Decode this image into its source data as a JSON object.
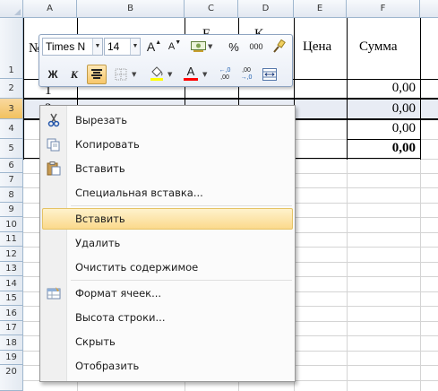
{
  "columns": [
    "A",
    "B",
    "C",
    "D",
    "E",
    "F"
  ],
  "rows": [
    "1",
    "2",
    "3",
    "4",
    "5",
    "6",
    "7",
    "8",
    "9",
    "10",
    "11",
    "12",
    "13",
    "14",
    "15",
    "16",
    "17",
    "18",
    "19",
    "20"
  ],
  "cells": {
    "a1": "№",
    "c1": "Е",
    "d1": "К",
    "e1": "Цена",
    "f1": "Сумма",
    "a2": "1",
    "a3": "2",
    "f2": "0,00",
    "f3": "0,00",
    "f4": "0,00",
    "f5": "0,00"
  },
  "mini_toolbar": {
    "font_name": "Times N",
    "font_size": "14",
    "grow_font": "A",
    "shrink_font": "A",
    "percent": "%",
    "thousands": "000",
    "bold": "Ж",
    "italic": "К",
    "font_color_letter": "A",
    "inc_decimal_top": "←,0",
    "inc_decimal_bottom": ",00",
    "dec_decimal_top": ",00",
    "dec_decimal_bottom": "→,0",
    "fill_color": "#ffff00",
    "font_color": "#ff0000"
  },
  "context_menu": {
    "items": [
      {
        "label": "Вырезать",
        "icon": "scissors-icon"
      },
      {
        "label": "Копировать",
        "icon": "copy-icon"
      },
      {
        "label": "Вставить",
        "icon": "paste-icon"
      },
      {
        "label": "Специальная вставка..."
      },
      {
        "label": "Вставить",
        "highlighted": true
      },
      {
        "label": "Удалить"
      },
      {
        "label": "Очистить содержимое"
      },
      {
        "label": "Формат ячеек...",
        "icon": "format-cells-icon"
      },
      {
        "label": "Высота строки..."
      },
      {
        "label": "Скрыть"
      },
      {
        "label": "Отобразить"
      }
    ]
  },
  "colors": {
    "header_bg": "#e2e8f1",
    "header_selected": "#f1c15f",
    "gridline": "#d4d4d4",
    "menu_highlight": "#fbd98c"
  }
}
